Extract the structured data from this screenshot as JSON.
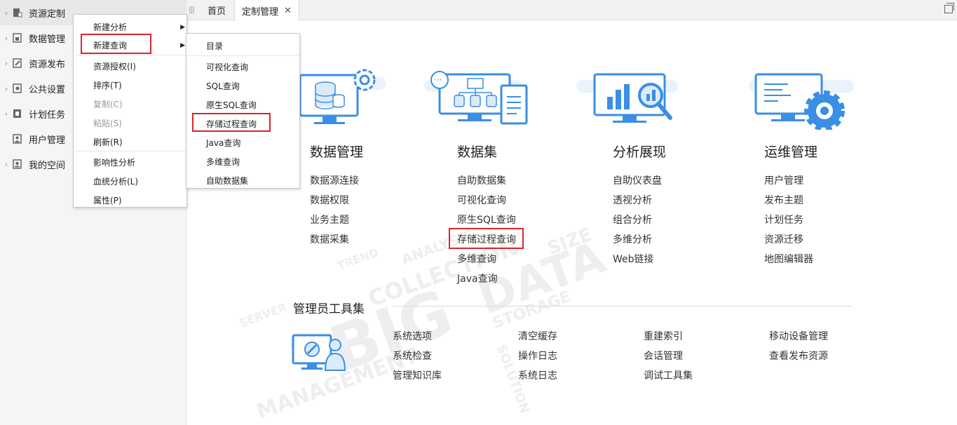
{
  "sidebar": {
    "items": [
      {
        "label": "资源定制"
      },
      {
        "label": "数据管理"
      },
      {
        "label": "资源发布"
      },
      {
        "label": "公共设置"
      },
      {
        "label": "计划任务"
      },
      {
        "label": "用户管理"
      },
      {
        "label": "我的空间"
      }
    ]
  },
  "tabs": [
    {
      "label": "首页"
    },
    {
      "label": "定制管理"
    }
  ],
  "context_menu": {
    "items": [
      {
        "label": "新建分析"
      },
      {
        "label": "新建查询"
      },
      {
        "label": "资源授权(I)"
      },
      {
        "label": "排序(T)"
      },
      {
        "label": "复制(C)"
      },
      {
        "label": "粘贴(S)"
      },
      {
        "label": "刷新(R)"
      },
      {
        "label": "影响性分析"
      },
      {
        "label": "血统分析(L)"
      },
      {
        "label": "属性(P)"
      }
    ]
  },
  "submenu": {
    "items": [
      {
        "label": "目录"
      },
      {
        "label": "可视化查询"
      },
      {
        "label": "SQL查询"
      },
      {
        "label": "原生SQL查询"
      },
      {
        "label": "存储过程查询"
      },
      {
        "label": "Java查询"
      },
      {
        "label": "多维查询"
      },
      {
        "label": "自助数据集"
      }
    ]
  },
  "categories": [
    {
      "title": "数据管理",
      "links": [
        "数据源连接",
        "数据权限",
        "业务主题",
        "数据采集"
      ]
    },
    {
      "title": "数据集",
      "links": [
        "自助数据集",
        "可视化查询",
        "原生SQL查询",
        "存储过程查询",
        "多维查询",
        "Java查询"
      ]
    },
    {
      "title": "分析展现",
      "links": [
        "自助仪表盘",
        "透视分析",
        "组合分析",
        "多维分析",
        "Web链接"
      ]
    },
    {
      "title": "运维管理",
      "links": [
        "用户管理",
        "发布主题",
        "计划任务",
        "资源迁移",
        "地图编辑器"
      ]
    }
  ],
  "tools": {
    "title": "管理员工具集",
    "columns": [
      [
        "系统选项",
        "系统检查",
        "管理知识库"
      ],
      [
        "清空缓存",
        "操作日志",
        "系统日志"
      ],
      [
        "重建索引",
        "会话管理",
        "调试工具集"
      ],
      [
        "移动设备管理",
        "查看发布资源"
      ]
    ]
  },
  "watermark": [
    "BIG",
    "DATA",
    "STORAGE",
    "COLLECTION",
    "MANAGEMENT",
    "TREND",
    "ANALYSIS",
    "SIZE",
    "SOLUTION",
    "SERVER"
  ],
  "colors": {
    "accent": "#3a8ee6",
    "highlight": "#d9252b",
    "sidebar_bg": "#f5f5f5",
    "icon_light": "#dcebf9"
  },
  "icons": {
    "sidebar": [
      "resource-icon",
      "data-icon",
      "publish-icon",
      "settings-icon",
      "task-icon",
      "user-icon",
      "space-icon"
    ]
  }
}
